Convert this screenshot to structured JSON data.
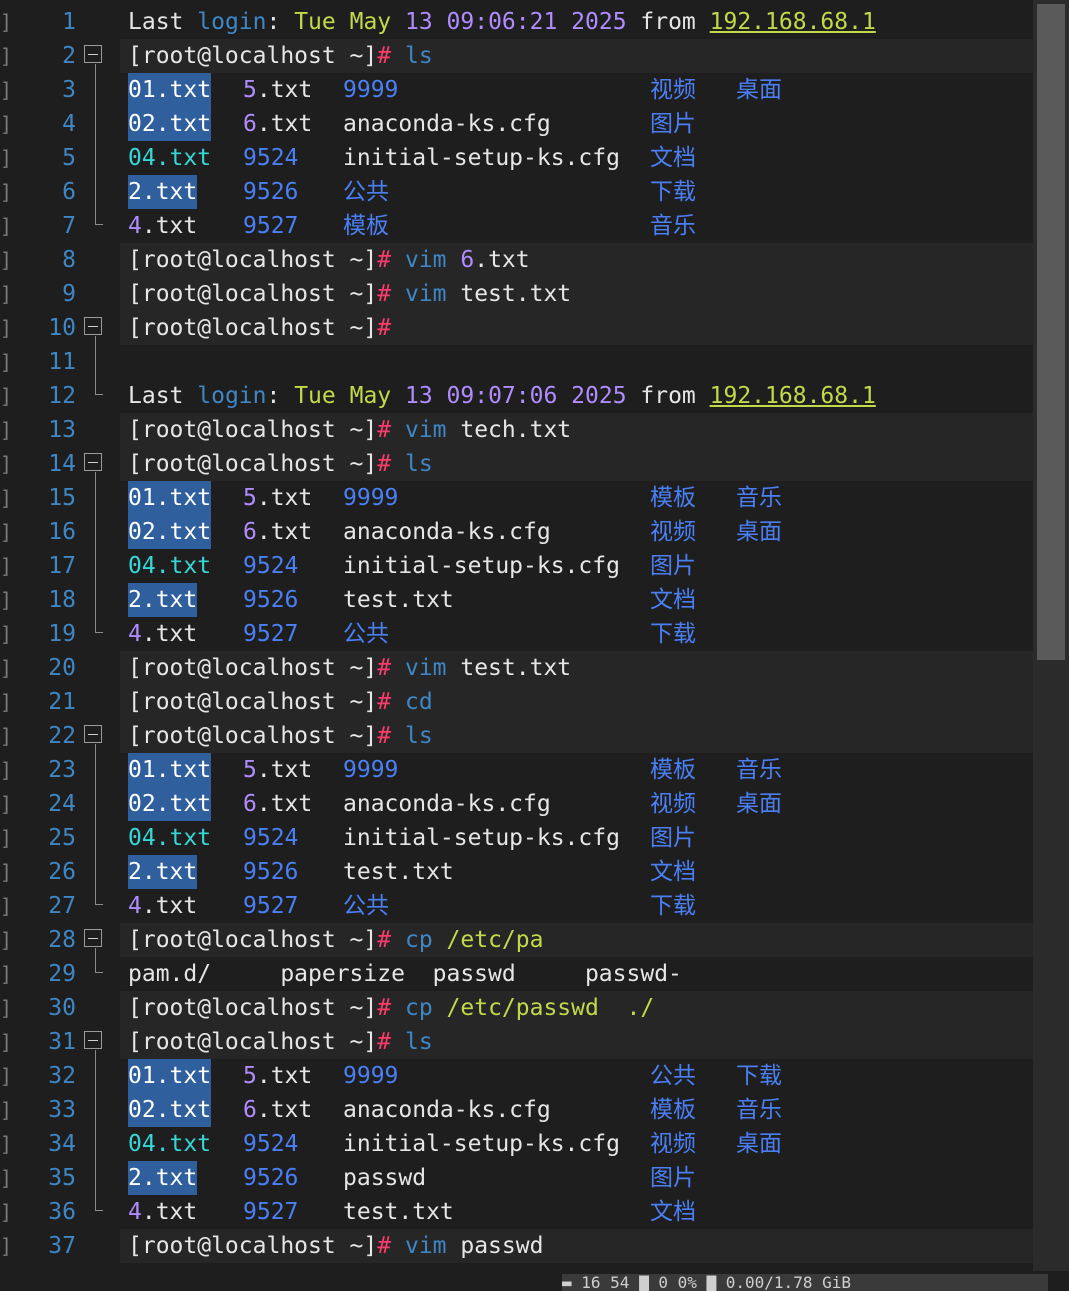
{
  "editor": {
    "lines": [
      {
        "n": "1",
        "tokens": [
          [
            "Last ",
            "w"
          ],
          [
            "login",
            "b"
          ],
          [
            ": ",
            "w"
          ],
          [
            "Tue May ",
            "y"
          ],
          [
            "13 09:06:21 2025",
            "p"
          ],
          [
            " from ",
            "w"
          ],
          [
            "192.168.68.1",
            "y ul"
          ]
        ]
      },
      {
        "n": "2",
        "tokens": [
          [
            "[root@localhost ~]",
            "w"
          ],
          [
            "#",
            "r"
          ],
          [
            " ",
            "w"
          ],
          [
            "ls",
            "b"
          ]
        ]
      },
      {
        "n": "3",
        "cols": [
          [
            "01.txt",
            "hl"
          ],
          [
            "5",
            "p",
            "5.txt"
          ],
          [
            "9999",
            "bl"
          ],
          [
            "视频",
            "bl"
          ],
          [
            "桌面",
            "bl"
          ]
        ]
      },
      {
        "n": "4",
        "cols": [
          [
            "02.txt",
            "hl"
          ],
          [
            "6",
            "p",
            "6.txt"
          ],
          [
            "anaconda-ks.cfg",
            "w"
          ],
          [
            "图片",
            "bl"
          ],
          [
            "",
            ""
          ]
        ]
      },
      {
        "n": "5",
        "cols": [
          [
            "04.txt",
            "c"
          ],
          [
            "9524",
            "bl"
          ],
          [
            "initial-setup-ks.cfg",
            "w"
          ],
          [
            "文档",
            "bl"
          ],
          [
            "",
            ""
          ]
        ]
      },
      {
        "n": "6",
        "cols": [
          [
            "2.txt",
            "hl"
          ],
          [
            "9526",
            "bl"
          ],
          [
            "公共",
            "bl"
          ],
          [
            "下载",
            "bl"
          ],
          [
            "",
            ""
          ]
        ]
      },
      {
        "n": "7",
        "cols": [
          [
            "4",
            "p",
            "4.txt"
          ],
          [
            "9527",
            "bl"
          ],
          [
            "模板",
            "bl"
          ],
          [
            "音乐",
            "bl"
          ],
          [
            "",
            ""
          ]
        ]
      },
      {
        "n": "8",
        "tokens": [
          [
            "[root@localhost ~]",
            "w"
          ],
          [
            "#",
            "r"
          ],
          [
            " ",
            "w"
          ],
          [
            "vim",
            "b"
          ],
          [
            " ",
            "w"
          ],
          [
            "6",
            "p"
          ],
          [
            ".txt",
            "w"
          ]
        ]
      },
      {
        "n": "9",
        "tokens": [
          [
            "[root@localhost ~]",
            "w"
          ],
          [
            "#",
            "r"
          ],
          [
            " ",
            "w"
          ],
          [
            "vim",
            "b"
          ],
          [
            " test.txt",
            "w"
          ]
        ]
      },
      {
        "n": "10",
        "tokens": [
          [
            "[root@localhost ~]",
            "w"
          ],
          [
            "#",
            "r"
          ]
        ]
      },
      {
        "n": "11",
        "tokens": []
      },
      {
        "n": "12",
        "tokens": [
          [
            "Last ",
            "w"
          ],
          [
            "login",
            "b"
          ],
          [
            ": ",
            "w"
          ],
          [
            "Tue May ",
            "y"
          ],
          [
            "13 09:07:06 2025",
            "p"
          ],
          [
            " from ",
            "w"
          ],
          [
            "192.168.68.1",
            "y ul"
          ]
        ]
      },
      {
        "n": "13",
        "tokens": [
          [
            "[root@localhost ~]",
            "w"
          ],
          [
            "#",
            "r"
          ],
          [
            " ",
            "w"
          ],
          [
            "vim",
            "b"
          ],
          [
            " tech.txt",
            "w"
          ]
        ]
      },
      {
        "n": "14",
        "tokens": [
          [
            "[root@localhost ~]",
            "w"
          ],
          [
            "#",
            "r"
          ],
          [
            " ",
            "w"
          ],
          [
            "ls",
            "b"
          ]
        ]
      },
      {
        "n": "15",
        "cols": [
          [
            "01.txt",
            "hl"
          ],
          [
            "5",
            "p",
            "5.txt"
          ],
          [
            "9999",
            "bl"
          ],
          [
            "模板",
            "bl"
          ],
          [
            "音乐",
            "bl"
          ]
        ]
      },
      {
        "n": "16",
        "cols": [
          [
            "02.txt",
            "hl"
          ],
          [
            "6",
            "p",
            "6.txt"
          ],
          [
            "anaconda-ks.cfg",
            "w"
          ],
          [
            "视频",
            "bl"
          ],
          [
            "桌面",
            "bl"
          ]
        ]
      },
      {
        "n": "17",
        "cols": [
          [
            "04.txt",
            "c"
          ],
          [
            "9524",
            "bl"
          ],
          [
            "initial-setup-ks.cfg",
            "w"
          ],
          [
            "图片",
            "bl"
          ],
          [
            "",
            ""
          ]
        ]
      },
      {
        "n": "18",
        "cols": [
          [
            "2.txt",
            "hl"
          ],
          [
            "9526",
            "bl"
          ],
          [
            "test.txt",
            "w"
          ],
          [
            "文档",
            "bl"
          ],
          [
            "",
            ""
          ]
        ]
      },
      {
        "n": "19",
        "cols": [
          [
            "4",
            "p",
            "4.txt"
          ],
          [
            "9527",
            "bl"
          ],
          [
            "公共",
            "bl"
          ],
          [
            "下载",
            "bl"
          ],
          [
            "",
            ""
          ]
        ]
      },
      {
        "n": "20",
        "tokens": [
          [
            "[root@localhost ~]",
            "w"
          ],
          [
            "#",
            "r"
          ],
          [
            " ",
            "w"
          ],
          [
            "vim",
            "b"
          ],
          [
            " test.txt",
            "w"
          ]
        ]
      },
      {
        "n": "21",
        "tokens": [
          [
            "[root@localhost ~]",
            "w"
          ],
          [
            "#",
            "r"
          ],
          [
            " ",
            "w"
          ],
          [
            "cd",
            "b"
          ]
        ]
      },
      {
        "n": "22",
        "tokens": [
          [
            "[root@localhost ~]",
            "w"
          ],
          [
            "#",
            "r"
          ],
          [
            " ",
            "w"
          ],
          [
            "ls",
            "b"
          ]
        ]
      },
      {
        "n": "23",
        "cols": [
          [
            "01.txt",
            "hl"
          ],
          [
            "5",
            "p",
            "5.txt"
          ],
          [
            "9999",
            "bl"
          ],
          [
            "模板",
            "bl"
          ],
          [
            "音乐",
            "bl"
          ]
        ]
      },
      {
        "n": "24",
        "cols": [
          [
            "02.txt",
            "hl"
          ],
          [
            "6",
            "p",
            "6.txt"
          ],
          [
            "anaconda-ks.cfg",
            "w"
          ],
          [
            "视频",
            "bl"
          ],
          [
            "桌面",
            "bl"
          ]
        ]
      },
      {
        "n": "25",
        "cols": [
          [
            "04.txt",
            "c"
          ],
          [
            "9524",
            "bl"
          ],
          [
            "initial-setup-ks.cfg",
            "w"
          ],
          [
            "图片",
            "bl"
          ],
          [
            "",
            ""
          ]
        ]
      },
      {
        "n": "26",
        "cols": [
          [
            "2.txt",
            "hl"
          ],
          [
            "9526",
            "bl"
          ],
          [
            "test.txt",
            "w"
          ],
          [
            "文档",
            "bl"
          ],
          [
            "",
            ""
          ]
        ]
      },
      {
        "n": "27",
        "cols": [
          [
            "4",
            "p",
            "4.txt"
          ],
          [
            "9527",
            "bl"
          ],
          [
            "公共",
            "bl"
          ],
          [
            "下载",
            "bl"
          ],
          [
            "",
            ""
          ]
        ]
      },
      {
        "n": "28",
        "tokens": [
          [
            "[root@localhost ~]",
            "w"
          ],
          [
            "#",
            "r"
          ],
          [
            " ",
            "w"
          ],
          [
            "cp",
            "b"
          ],
          [
            " ",
            "w"
          ],
          [
            "/etc/pa",
            "y"
          ]
        ]
      },
      {
        "n": "29",
        "tokens": [
          [
            "pam.d/     papersize  passwd     passwd-",
            "w"
          ]
        ]
      },
      {
        "n": "30",
        "tokens": [
          [
            "[root@localhost ~]",
            "w"
          ],
          [
            "#",
            "r"
          ],
          [
            " ",
            "w"
          ],
          [
            "cp",
            "b"
          ],
          [
            " ",
            "w"
          ],
          [
            "/etc/passwd  ./",
            "y"
          ]
        ]
      },
      {
        "n": "31",
        "tokens": [
          [
            "[root@localhost ~]",
            "w"
          ],
          [
            "#",
            "r"
          ],
          [
            " ",
            "w"
          ],
          [
            "ls",
            "b"
          ]
        ]
      },
      {
        "n": "32",
        "cols": [
          [
            "01.txt",
            "hl"
          ],
          [
            "5",
            "p",
            "5.txt"
          ],
          [
            "9999",
            "bl"
          ],
          [
            "公共",
            "bl"
          ],
          [
            "下载",
            "bl"
          ]
        ]
      },
      {
        "n": "33",
        "cols": [
          [
            "02.txt",
            "hl"
          ],
          [
            "6",
            "p",
            "6.txt"
          ],
          [
            "anaconda-ks.cfg",
            "w"
          ],
          [
            "模板",
            "bl"
          ],
          [
            "音乐",
            "bl"
          ]
        ]
      },
      {
        "n": "34",
        "cols": [
          [
            "04.txt",
            "c"
          ],
          [
            "9524",
            "bl"
          ],
          [
            "initial-setup-ks.cfg",
            "w"
          ],
          [
            "视频",
            "bl"
          ],
          [
            "桌面",
            "bl"
          ]
        ]
      },
      {
        "n": "35",
        "cols": [
          [
            "2.txt",
            "hl"
          ],
          [
            "9526",
            "bl"
          ],
          [
            "passwd",
            "w"
          ],
          [
            "图片",
            "bl"
          ],
          [
            "",
            ""
          ]
        ]
      },
      {
        "n": "36",
        "cols": [
          [
            "4",
            "p",
            "4.txt"
          ],
          [
            "9527",
            "bl"
          ],
          [
            "test.txt",
            "w"
          ],
          [
            "文档",
            "bl"
          ],
          [
            "",
            ""
          ]
        ]
      },
      {
        "n": "37",
        "tokens": [
          [
            "[root@localhost ~]",
            "w"
          ],
          [
            "#",
            "r"
          ],
          [
            " ",
            "w"
          ],
          [
            "vim",
            "b"
          ],
          [
            " passwd",
            "w"
          ]
        ]
      }
    ],
    "folds": [
      {
        "start": "2",
        "end": "7"
      },
      {
        "start": "10",
        "end": "12"
      },
      {
        "start": "14",
        "end": "19"
      },
      {
        "start": "22",
        "end": "27"
      },
      {
        "start": "28",
        "end": "29"
      },
      {
        "start": "31",
        "end": "36"
      }
    ],
    "shaded_lines": [
      "2",
      "8",
      "9",
      "10",
      "13",
      "14",
      "20",
      "21",
      "22",
      "28",
      "30",
      "31",
      "37"
    ]
  },
  "colors": {
    "background": "#1e1e1e",
    "line_number": "#3f86c4",
    "prompt_hash": "#ff3b6b",
    "command": "#3f86c4",
    "highlight_bg": "#2f5f9c",
    "executable": "#36d7d7",
    "date_time": "#b08cff",
    "yellow": "#c3d94a"
  },
  "statusbar": {
    "text": "▬ 16  54  ▇ 0  0%  ▇ 0.00/1.78 GiB"
  }
}
